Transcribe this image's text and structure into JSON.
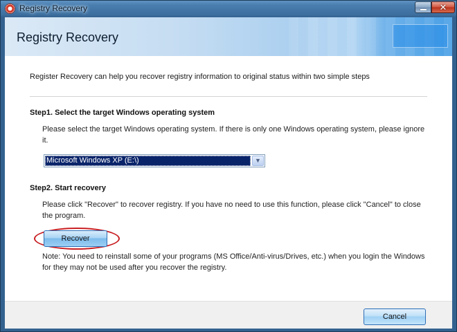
{
  "window": {
    "title": "Registry Recovery",
    "close_glyph": "✕",
    "icon": "lifebuoy-icon"
  },
  "header": {
    "title": "Registry Recovery"
  },
  "intro": "Register Recovery can help you recover registry information to original status within two simple steps",
  "step1": {
    "title": "Step1. Select the target Windows operating system",
    "description": "Please select the target Windows operating system. If there is only one Windows operating system, please ignore it.",
    "selected_os": "Microsoft Windows XP (E:\\)"
  },
  "step2": {
    "title": "Step2. Start recovery",
    "description": "Please click \"Recover\" to recover registry. If you have no need to use this function, please click \"Cancel\" to close the program.",
    "recover_label": "Recover",
    "note": "Note: You need to reinstall some of your programs (MS Office/Anti-virus/Drives, etc.) when you login the Windows for they may not be used after you recover the registry."
  },
  "footer": {
    "cancel_label": "Cancel"
  },
  "colors": {
    "highlight_ring": "#c81e22",
    "selection_bg": "#0a246a",
    "title_bar": "#3d6f9f"
  }
}
